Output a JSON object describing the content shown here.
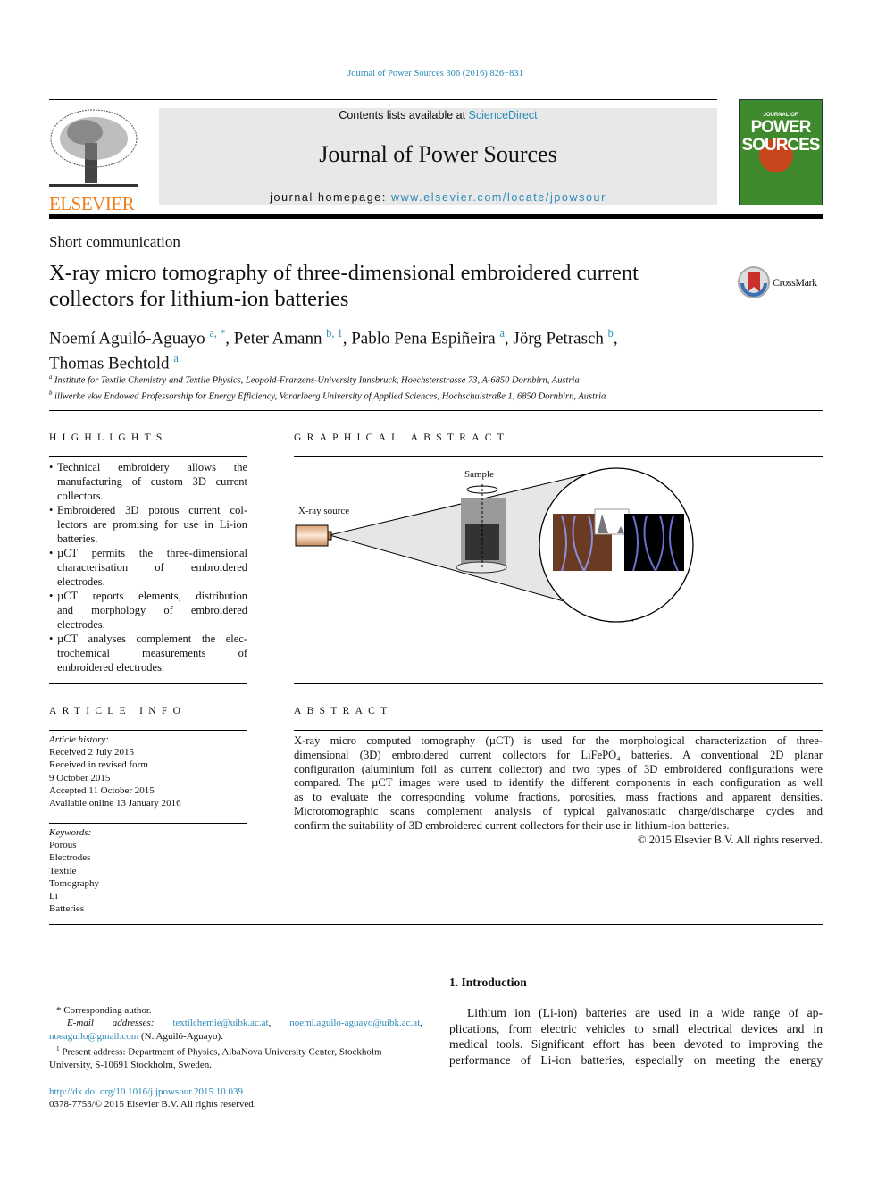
{
  "header": {
    "journal_ref": "Journal of Power Sources 306 (2016) 826−831",
    "contents_prefix": "Contents lists available at ",
    "sciencedirect": "ScienceDirect",
    "journal_title": "Journal of Power Sources",
    "homepage_prefix": "journal homepage: ",
    "homepage_url": "www.elsevier.com/locate/jpowsour",
    "publisher": "ELSEVIER",
    "cover_title_top": "JOURNAL OF",
    "cover_title_1": "POWER",
    "cover_title_2": "SOURCES",
    "crossmark": "CrossMark"
  },
  "article": {
    "type": "Short communication",
    "title_lines": [
      "X-ray micro tomography of three-dimensional embroidered current",
      "collectors for lithium-ion batteries"
    ],
    "authors": [
      {
        "name": "Noemí Aguiló-Aguayo",
        "sup": "a, *",
        "sep": ", "
      },
      {
        "name": "Peter Amann",
        "sup": "b, 1",
        "sep": ", "
      },
      {
        "name": "Pablo Pena Espiñeira",
        "sup": "a",
        "sep": ", "
      },
      {
        "name": "Jörg Petrasch",
        "sup": "b",
        "sep": ","
      },
      {
        "name": "Thomas Bechtold",
        "sup": "a",
        "sep": ""
      }
    ],
    "affiliations": [
      {
        "mark": "a",
        "text": "Institute for Textile Chemistry and Textile Physics, Leopold-Franzens-University Innsbruck, Hoechsterstrasse 73, A-6850 Dornbirn, Austria"
      },
      {
        "mark": "b",
        "text": "illwerke vkw Endowed Professorship for Energy Efficiency, Vorarlberg University of Applied Sciences, Hochschulstraße 1, 6850 Dornbirn, Austria"
      }
    ]
  },
  "highlights": {
    "heading": "HIGHLIGHTS",
    "lines": [
      [
        "•",
        "Technical embroidery allows the"
      ],
      [
        "",
        "manufacturing of custom 3D current"
      ],
      [
        "",
        "collectors."
      ],
      [
        "•",
        "Embroidered 3D porous current col-"
      ],
      [
        "",
        "lectors are promising for use in Li-ion"
      ],
      [
        "",
        "batteries."
      ],
      [
        "•",
        "µCT permits the three-dimensional"
      ],
      [
        "",
        "characterisation of embroidered"
      ],
      [
        "",
        "electrodes."
      ],
      [
        "•",
        "µCT reports elements, distribution"
      ],
      [
        "",
        "and morphology of embroidered"
      ],
      [
        "",
        "electrodes."
      ],
      [
        "•",
        "µCT analyses complement the elec-"
      ],
      [
        "",
        "trochemical measurements of"
      ],
      [
        "",
        "embroidered electrodes."
      ]
    ]
  },
  "graphical_abstract": {
    "heading": "GRAPHICAL ABSTRACT",
    "sample_label": "Sample",
    "source_label": "X-ray source"
  },
  "article_info": {
    "heading": "ARTICLE INFO",
    "history_label": "Article history:",
    "history": [
      "Received 2 July 2015",
      "Received in revised form",
      "9 October 2015",
      "Accepted 11 October 2015",
      "Available online 13 January 2016"
    ],
    "keywords_label": "Keywords:",
    "keywords": [
      "Porous",
      "Electrodes",
      "Textile",
      "Tomography",
      "Li",
      "Batteries"
    ]
  },
  "abstract": {
    "heading": "ABSTRACT",
    "lines": [
      "X-ray micro computed tomography (µCT) is used for the morphological characterization of three-",
      "dimensional (3D) embroidered current collectors for LiFePO₄ batteries. A conventional 2D planar",
      "configuration (aluminium foil as current collector) and two types of 3D embroidered configurations were",
      "compared. The µCT images were used to identify the different components in each configuration as well",
      "as to evaluate the corresponding volume fractions, porosities, mass fractions and apparent densities.",
      "Microtomographic scans complement analysis of typical galvanostatic charge/discharge cycles and",
      "confirm the suitability of 3D embroidered current collectors for their use in lithium-ion batteries."
    ],
    "copyright": "© 2015 Elsevier B.V. All rights reserved."
  },
  "introduction": {
    "heading": "1.  Introduction",
    "lines": [
      "Lithium ion (Li-ion) batteries are used in a wide range of ap-",
      "plications, from electric vehicles to small electrical devices and in",
      "medical tools. Significant effort has been devoted to improving the",
      "performance of Li-ion batteries, especially on meeting the energy"
    ]
  },
  "footnotes": {
    "corresponding": "Corresponding author.",
    "email_label": "E-mail addresses:",
    "emails": [
      "textilchemie@uibk.ac.at",
      "noemi.aguilo-aguayo@uibk.ac.at",
      "noeaguilo@gmail.com"
    ],
    "email_owner": "(N. Aguiló-Aguayo).",
    "present_mark": "1",
    "present_line1": "Present address: Department of Physics, AlbaNova University Center, Stockholm",
    "present_line2": "University, S-10691 Stockholm, Sweden.",
    "doi": "http://dx.doi.org/10.1016/j.jpowsour.2015.10.039",
    "issn": "0378-7753/© 2015 Elsevier B.V. All rights reserved."
  },
  "colors": {
    "link": "#2a8ab8",
    "publisher": "#f07d1a",
    "cover": "#3f8a2c",
    "banner": "#e8e8e8"
  }
}
